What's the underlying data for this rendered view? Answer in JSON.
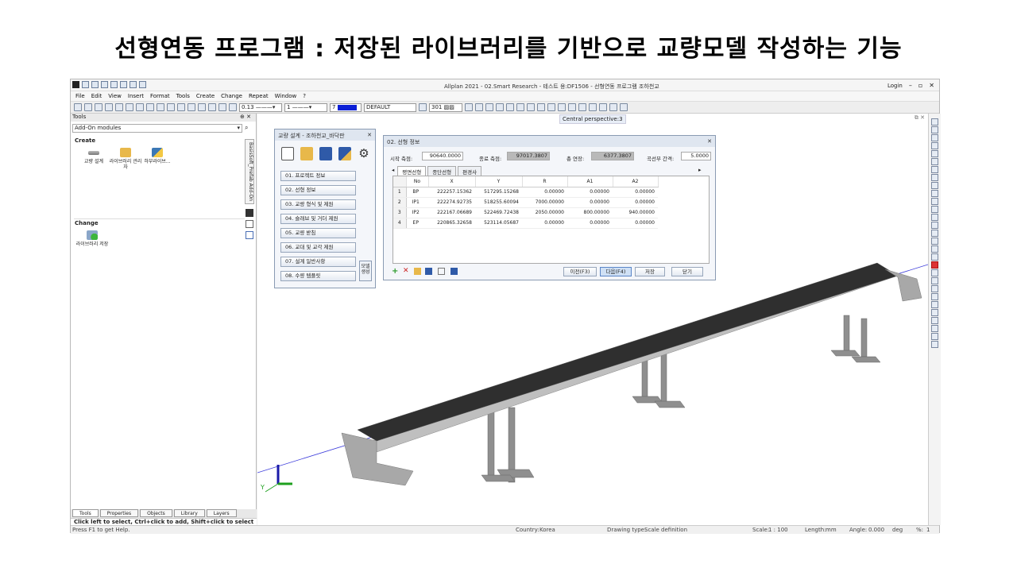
{
  "slide_title": "선형연동 프로그램 : 저장된 라이브러리를 기반으로 교량모델 작성하는 기능",
  "window": {
    "title": "Allplan 2021 - 02.Smart Research - 테스트 용:DF1506 - 선형연동 프로그램 조하천교",
    "login": "Login"
  },
  "menu": [
    "File",
    "Edit",
    "View",
    "Insert",
    "Format",
    "Tools",
    "Create",
    "Change",
    "Repeat",
    "Window",
    "?"
  ],
  "toolbar": {
    "pen": "0.13",
    "line": "1",
    "color": "7",
    "layer": "DEFAULT",
    "pattern": "301"
  },
  "tools_panel": {
    "header": "Tools",
    "pin": "⊕ ✕",
    "combo": "Add-On modules",
    "side_tab": "BasisSoft_Prefab Add-On",
    "create_label": "Create",
    "create_modules": [
      "교량 설계",
      "라이브러리 관리자",
      "하부라이브..."
    ],
    "change_label": "Change",
    "change_modules": [
      "라이브러리 저장"
    ]
  },
  "bottom_tabs": [
    "Tools",
    "Properties",
    "Objects",
    "Library",
    "Layers"
  ],
  "hint": "Click left to select, Ctrl+click to add, Shift+click to select entity group",
  "status": {
    "help": "Press F1 to get Help.",
    "country_label": "Country:",
    "country": "Korea",
    "drawing_type_label": "Drawing type:",
    "drawing_type": "Scale definition",
    "scale_label": "Scale:",
    "scale": "1 : 100",
    "length_label": "Length:",
    "length": "mm",
    "angle_label": "Angle:",
    "angle": "0.000",
    "angle_unit": "deg",
    "percent_label": "%:",
    "percent": "1"
  },
  "viewport": {
    "label": "Central perspective:3",
    "axis_y": "Y"
  },
  "dialog1": {
    "title": "교량 설계 - 조하천교_바닥판",
    "steps": [
      "01. 프로젝트 정보",
      "02. 선형 정보",
      "03. 교량 형식 및 제원",
      "04. 슬래브 및 거더 제원",
      "05. 교량 받침",
      "06. 교대 및 교각 제원",
      "07. 설계 일반사항",
      "08. 수량 템플릿"
    ],
    "side_button": "모델 생성"
  },
  "dialog2": {
    "title": "02. 선형 정보",
    "start_label": "시작 측점:",
    "start_value": "90640.0000",
    "end_label": "종료 측점:",
    "end_value": "97017.3807",
    "total_label": "총 연장:",
    "total_value": "6377.3807",
    "curve_label": "곡선부 간격:",
    "curve_value": "5.0000",
    "tabs": [
      "평면선형",
      "종단선형",
      "편경사"
    ],
    "columns": [
      "No",
      "X",
      "Y",
      "R",
      "A1",
      "A2"
    ],
    "rows": [
      {
        "n": "1",
        "no": "BP",
        "x": "222257.15362",
        "y": "517295.15268",
        "r": "0.00000",
        "a1": "0.00000",
        "a2": "0.00000"
      },
      {
        "n": "2",
        "no": "IP1",
        "x": "222274.92735",
        "y": "518255.60094",
        "r": "7000.00000",
        "a1": "0.00000",
        "a2": "0.00000"
      },
      {
        "n": "3",
        "no": "IP2",
        "x": "222167.06689",
        "y": "522469.72438",
        "r": "2050.00000",
        "a1": "800.00000",
        "a2": "940.00000"
      },
      {
        "n": "4",
        "no": "EP",
        "x": "220865.32658",
        "y": "523114.05687",
        "r": "0.00000",
        "a1": "0.00000",
        "a2": "0.00000"
      }
    ],
    "btn_prev": "이전(F3)",
    "btn_next": "다음(F4)",
    "btn_save": "저장",
    "btn_close": "닫기"
  }
}
